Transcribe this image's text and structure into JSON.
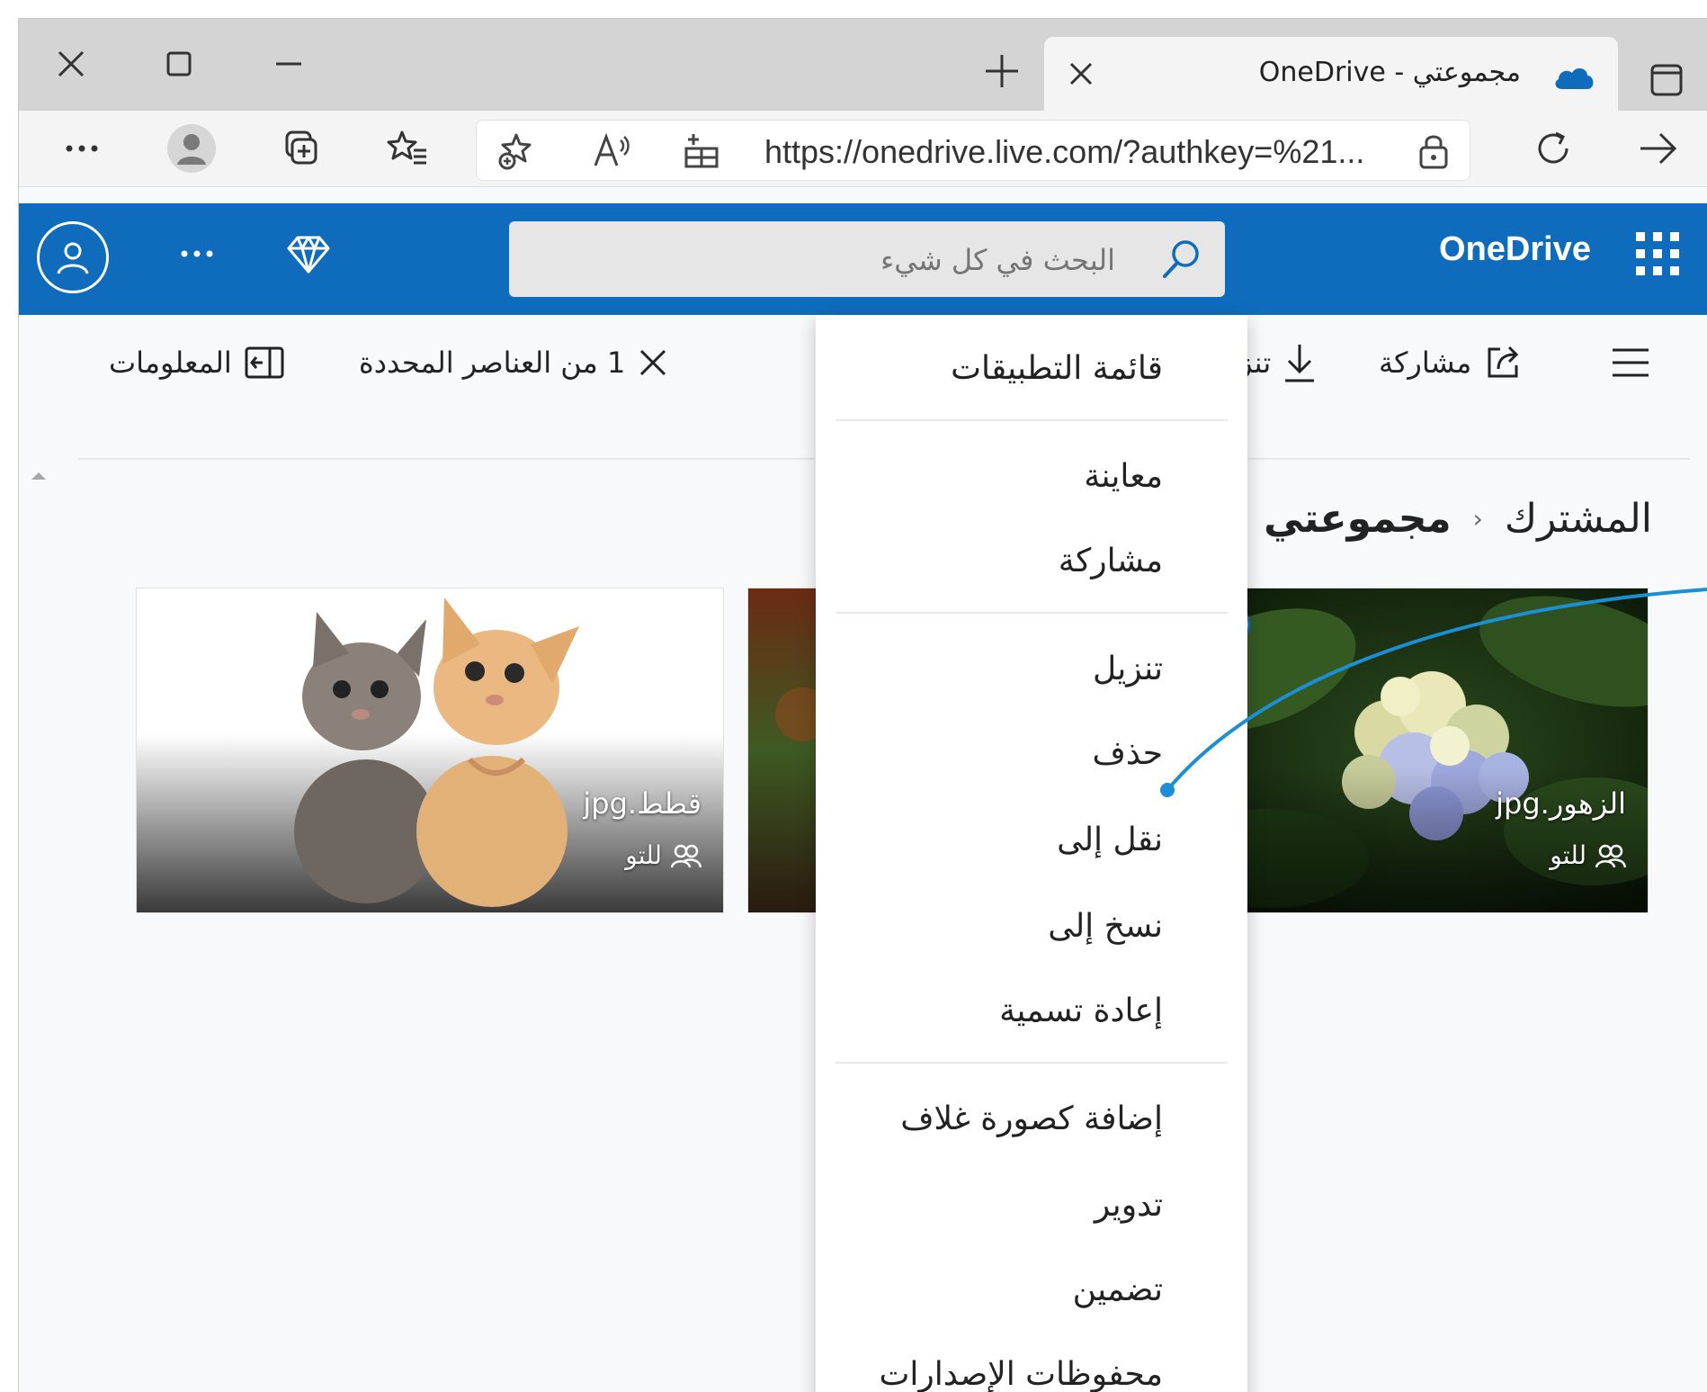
{
  "browser": {
    "tab_title": "مجموعتي - OneDrive",
    "url": "https://onedrive.live.com/?authkey=%21..."
  },
  "onedrive": {
    "brand": "OneDrive",
    "search_placeholder": "البحث في كل شيء"
  },
  "commandbar": {
    "share": "مشاركة",
    "download_partial": "تنز",
    "selected": "1 من العناصر المحددة",
    "info": "المعلومات"
  },
  "breadcrumb": {
    "root": "المشترك",
    "current": "مجموعتي"
  },
  "tiles": [
    {
      "name": "الزهور.jpg",
      "owner": "للتو",
      "selected": true
    },
    {
      "name": "قطط.jpg",
      "owner": "للتو",
      "selected": false
    }
  ],
  "context_menu": {
    "items": [
      "قائمة التطبيقات",
      "معاينة",
      "مشاركة",
      "تنزيل",
      "حذف",
      "نقل إلى",
      "نسخ إلى",
      "إعادة تسمية",
      "إضافة كصورة غلاف",
      "تدوير",
      "تضمين",
      "محفوظات الإصدارات"
    ]
  },
  "colors": {
    "onedrive_blue": "#0f6cbd",
    "callout": "#1a8fd6"
  }
}
